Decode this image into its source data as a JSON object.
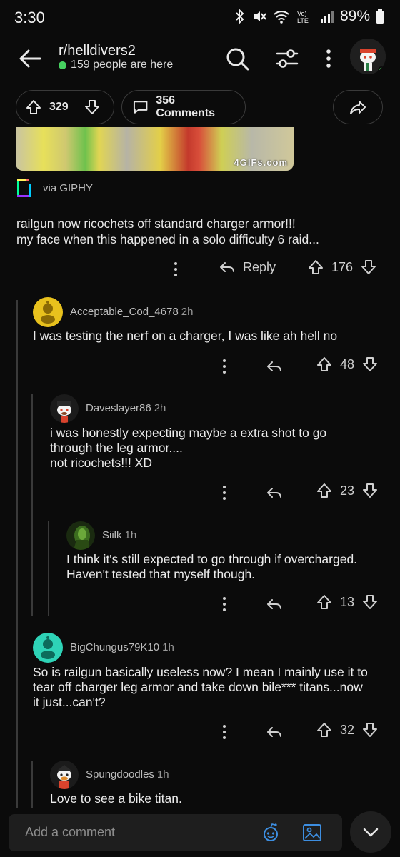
{
  "status_bar": {
    "time": "3:30",
    "battery": "89%"
  },
  "header": {
    "subreddit": "r/helldivers2",
    "online": "159 people are here",
    "icons": [
      "back-arrow-icon",
      "search-icon",
      "filter-icon",
      "more-vert-icon",
      "avatar"
    ]
  },
  "post_bar": {
    "score": "329",
    "comments_label": "356 Comments"
  },
  "gif": {
    "watermark": "4GIFs.com",
    "source_label": "via GIPHY"
  },
  "top_comment": {
    "line1": "railgun now ricochets off standard charger armor!!!",
    "line2": "my face when this happened in a solo difficulty 6 raid...",
    "reply_label": "Reply",
    "score": "176"
  },
  "comments": [
    {
      "user": "Acceptable_Cod_4678",
      "time": "2h",
      "text": "I was testing the nerf on a charger, I was like ah hell no",
      "score": "48"
    },
    {
      "user": "Daveslayer86",
      "time": "2h",
      "line1": "i was honestly expecting maybe a extra shot to go",
      "line2": "through the leg armor....",
      "line3": "not ricochets!!! XD",
      "score": "23"
    },
    {
      "user": "Siilk",
      "time": "1h",
      "line1": "I think it's still expected to go through if overcharged.",
      "line2": "Haven't tested that myself though.",
      "score": "13"
    },
    {
      "user": "BigChungus79K10",
      "time": "1h",
      "line1": "So is railgun basically useless now? I mean I mainly use it to",
      "line2": "tear off charger leg armor and take down bile*** titans...now",
      "line3": "it just...can't?",
      "score": "32"
    },
    {
      "user": "Spungdoodles",
      "time": "1h",
      "text": "Love to see a bike titan."
    }
  ],
  "composer": {
    "placeholder": "Add a comment"
  },
  "colors": {
    "background": "#0b0b0b",
    "online_green": "#46d160",
    "snoo_teal": "#2ed3b7",
    "snoo_yellow": "#e8c11d"
  }
}
